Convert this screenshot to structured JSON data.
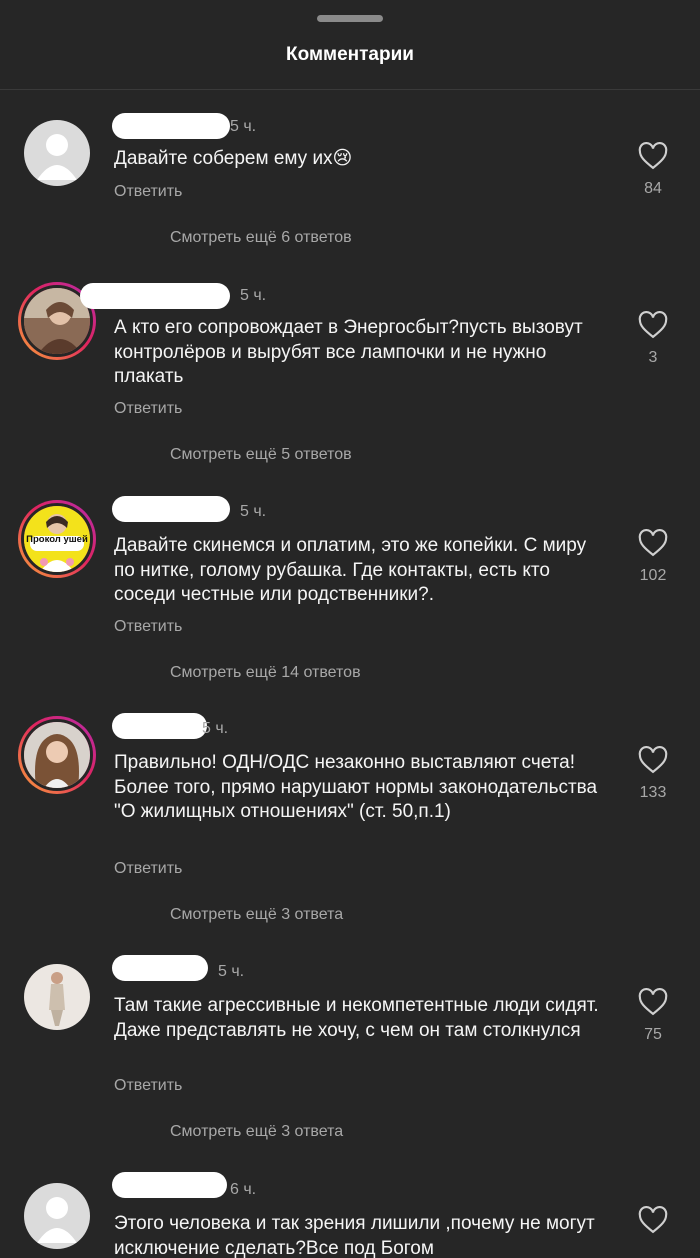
{
  "header": {
    "title": "Комментарии"
  },
  "comments": [
    {
      "time": "5 ч.",
      "text": "Давайте соберем ему их😢",
      "reply_label": "Ответить",
      "likes": "84",
      "more_replies": "Смотреть ещё 6 ответов",
      "avatar": "default-avatar"
    },
    {
      "time": "5 ч.",
      "text": "А кто его сопровождает в Энергосбыт?пусть вызовут контролёров и вырубят все лампочки и не нужно плакать",
      "reply_label": "Ответить",
      "likes": "3",
      "more_replies": "Смотреть ещё 5 ответов",
      "avatar": "photo-avatar"
    },
    {
      "time": "5 ч.",
      "text": "Давайте скинемся и оплатим, это же копейки. С миру по нитке, голому рубашка. Где контакты, есть кто соседи честные или родственники?.",
      "reply_label": "Ответить",
      "likes": "102",
      "more_replies": "Смотреть ещё 14 ответов",
      "avatar": "ear-piercing-avatar",
      "avatar_caption": "Прокол ушей"
    },
    {
      "time": "5 ч.",
      "text": "Правильно! ОДН/ОДС незаконно выставляют счета! Более того, прямо нарушают нормы законодательства \"О жилищных отношениях\" (ст. 50,п.1)",
      "reply_label": "Ответить",
      "likes": "133",
      "more_replies": "Смотреть ещё 3 ответа",
      "avatar": "photo-avatar"
    },
    {
      "time": "5 ч.",
      "text": "Там такие агрессивные и некомпетентные люди сидят. Даже представлять не хочу, с чем он там столкнулся",
      "reply_label": "Ответить",
      "likes": "75",
      "more_replies": "Смотреть ещё 3 ответа",
      "avatar": "photo-avatar"
    },
    {
      "time": "6 ч.",
      "text": "Этого человека и так зрения лишили ,почему не могут исключение сделать?Все под Богом",
      "reply_label": "",
      "likes": "",
      "more_replies": "",
      "avatar": "default-avatar"
    }
  ],
  "colors": {
    "background": "#262626",
    "text": "#f5f5f5",
    "muted": "#a8a8a8",
    "story_ring": "#e0245e"
  }
}
